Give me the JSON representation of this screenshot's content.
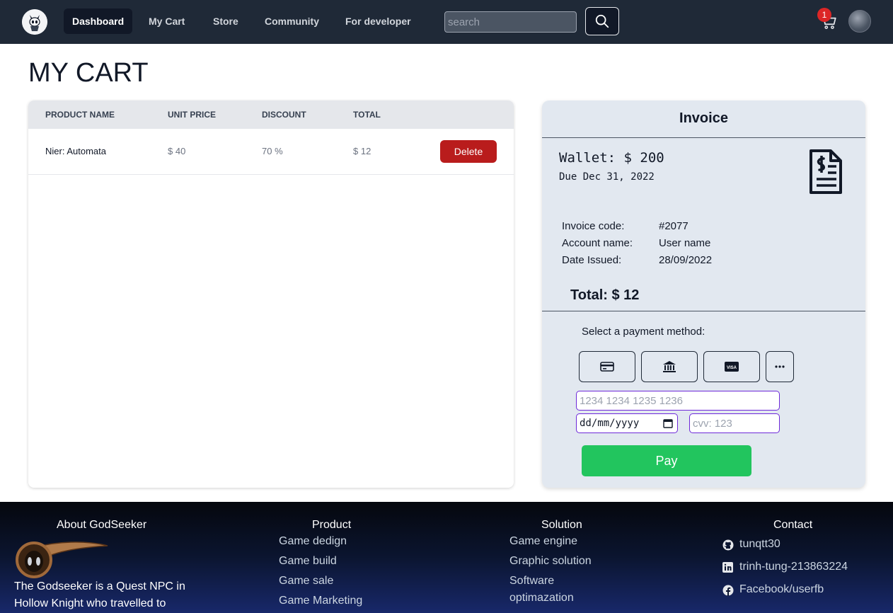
{
  "nav": {
    "items": [
      "Dashboard",
      "My Cart",
      "Store",
      "Community",
      "For developer"
    ],
    "search_placeholder": "search",
    "cart_count": "1"
  },
  "page": {
    "title": "MY CART"
  },
  "cart": {
    "headers": [
      "PRODUCT NAME",
      "UNIT PRICE",
      "DISCOUNT",
      "TOTAL"
    ],
    "rows": [
      {
        "name": "Nier: Automata",
        "unit_price": "$ 40",
        "discount": "70 %",
        "total": "$ 12",
        "action": "Delete"
      }
    ]
  },
  "invoice": {
    "title": "Invoice",
    "wallet": "Wallet: $ 200",
    "due": "Due Dec 31, 2022",
    "details": [
      {
        "label": "Invoice code:",
        "value": "#2077"
      },
      {
        "label": "Account name:",
        "value": "User name"
      },
      {
        "label": "Date Issued:",
        "value": "28/09/2022"
      }
    ],
    "total": "Total: $ 12",
    "payment_label": "Select a payment method:",
    "payment_methods": [
      "credit-card-icon",
      "bank-icon",
      "visa-icon",
      "more-icon"
    ],
    "card_placeholder": "1234 1234 1235 1236",
    "date_value": "dd/mm/yyyy",
    "cvv_placeholder": "cvv: 123",
    "pay_label": "Pay"
  },
  "footer": {
    "about": {
      "title": "About GodSeeker",
      "text_line1": "The Godseeker is a Quest NPC in",
      "text_line2": "Hollow Knight who travelled to"
    },
    "product": {
      "title": "Product",
      "links": [
        "Game dedign",
        "Game build",
        "Game sale",
        "Game Marketing"
      ]
    },
    "solution": {
      "title": "Solution",
      "links": [
        "Game engine",
        "Graphic solution",
        "Software",
        "optimazation"
      ]
    },
    "contact": {
      "title": "Contact",
      "github": "tunqtt30",
      "linkedin": "trinh-tung-213863224",
      "facebook": "Facebook/userfb"
    }
  },
  "colors": {
    "nav_bg": "#1f2937",
    "delete": "#b91c1c",
    "pay": "#22c55e",
    "invoice_bg": "#e2e8f0"
  }
}
